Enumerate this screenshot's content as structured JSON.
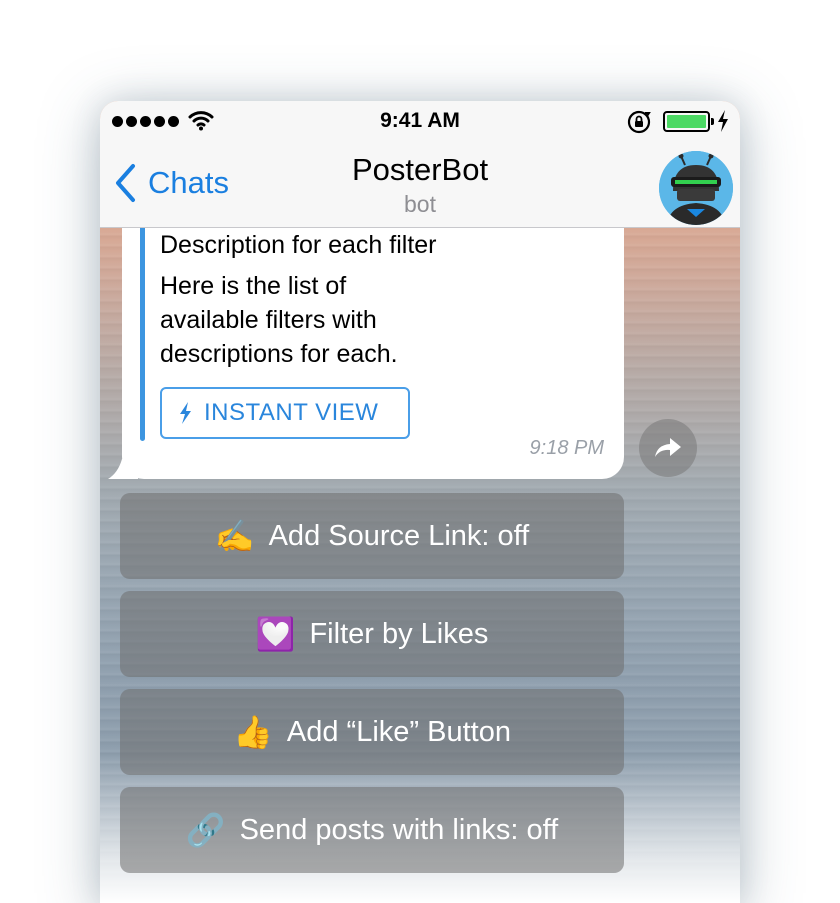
{
  "status_bar": {
    "time": "9:41 AM",
    "signal_icon": "signal-dots-icon",
    "wifi_icon": "wifi-icon",
    "rotation_lock_icon": "rotation-lock-icon",
    "battery_icon": "battery-icon",
    "charging_icon": "charging-bolt-icon",
    "battery_level": 1.0,
    "battery_color": "#4cd964"
  },
  "nav": {
    "back_label": "Chats",
    "title": "PosterBot",
    "subtitle": "bot",
    "accent_color": "#1a7fe0"
  },
  "message": {
    "preview_title": "Description for each filter",
    "preview_text": "Here is the list of\navailable filters with\ndescriptions for each.",
    "instant_view_label": "INSTANT VIEW",
    "time": "9:18 PM",
    "quote_color": "#3c95e0"
  },
  "keyboard": {
    "buttons": [
      {
        "emoji": "✍️",
        "label": "Add Source Link: off"
      },
      {
        "emoji": "💟",
        "label": "Filter by Likes"
      },
      {
        "emoji": "👍",
        "label": "Add “Like” Button"
      },
      {
        "emoji": "🔗",
        "label": "Send posts with links: off"
      }
    ]
  }
}
